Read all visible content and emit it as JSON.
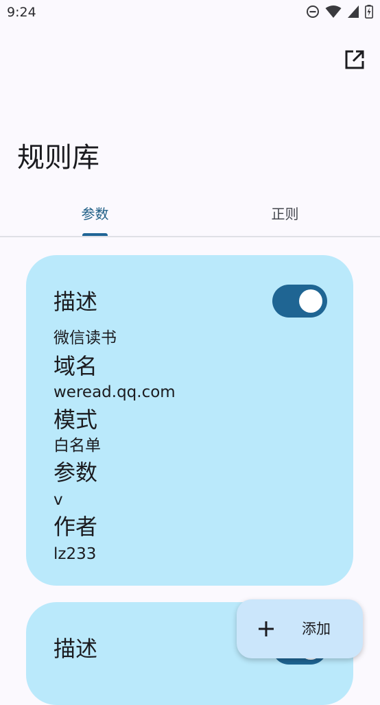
{
  "status_bar": {
    "time": "9:24"
  },
  "app_bar": {
    "title": "规则库",
    "action_icon": "open-in-new-icon"
  },
  "tabs": [
    {
      "label": "参数",
      "selected": true
    },
    {
      "label": "正则",
      "selected": false
    }
  ],
  "rules": [
    {
      "enabled": true,
      "fields": [
        {
          "label": "描述",
          "value": "微信读书"
        },
        {
          "label": "域名",
          "value": "weread.qq.com"
        },
        {
          "label": "模式",
          "value": "白名单"
        },
        {
          "label": "参数",
          "value": "v"
        },
        {
          "label": "作者",
          "value": "lz233"
        }
      ]
    },
    {
      "enabled": true,
      "fields": [
        {
          "label": "描述"
        }
      ]
    }
  ],
  "fab": {
    "label": "添加",
    "icon": "plus-icon"
  },
  "colors": {
    "accent": "#1f6593",
    "card": "#bae9fb",
    "fab": "#cbe6fb",
    "background": "#fbf9fe"
  }
}
